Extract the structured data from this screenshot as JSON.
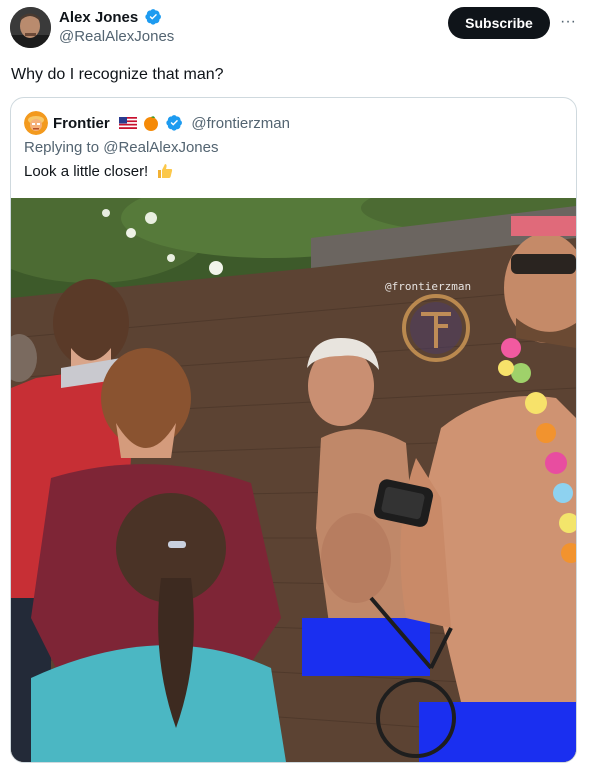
{
  "tweet": {
    "author": {
      "name": "Alex Jones",
      "handle": "@RealAlexJones",
      "verified": true
    },
    "subscribe_label": "Subscribe",
    "more_label": "···",
    "text": "Why do I recognize that man?"
  },
  "quoted_tweet": {
    "author": {
      "name": "Frontier",
      "handle": "@frontierzman",
      "verified": true,
      "flag_icon": "us-flag-icon",
      "emoji_icon": "orange-icon"
    },
    "replying_to": "Replying to @RealAlexJones",
    "text": "Look a little closer!",
    "text_emoji_icon": "thumbs-up-icon",
    "image": {
      "watermark": "@frontierzman"
    }
  },
  "colors": {
    "verified_blue": "#1d9bf0",
    "button_dark": "#0f1419",
    "secondary_text": "#536471",
    "border": "#cfd9de",
    "censor_blue": "#1a2ff0"
  }
}
